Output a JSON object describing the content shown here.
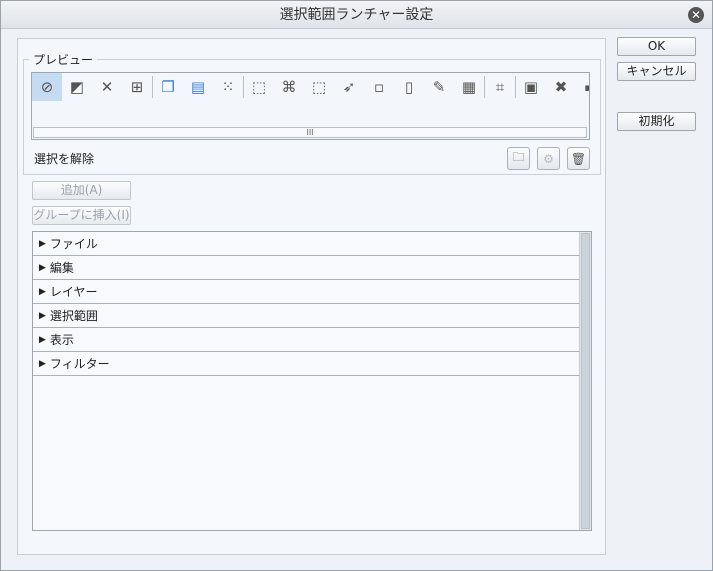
{
  "window": {
    "title": "選択範囲ランチャー設定"
  },
  "buttons": {
    "ok": "OK",
    "cancel": "キャンセル",
    "reset": "初期化",
    "add": "追加(A)",
    "insert_group": "グループに挿入(I)"
  },
  "preview": {
    "legend": "プレビュー",
    "icons": [
      "deselect-icon",
      "invert-selection-icon",
      "expand-selection-icon",
      "shrink-selection-icon",
      "copy-icon",
      "paste-icon",
      "points-icon",
      "transform-icon",
      "scale-icon",
      "free-transform-icon",
      "fill-icon",
      "new-layer-icon",
      "selection-layer-icon",
      "brush-icon",
      "checker-icon",
      "crop-icon",
      "frame-icon",
      "x-icon",
      "more-icon"
    ],
    "scroll_grip": "III",
    "selected_action": "選択を解除"
  },
  "tree": {
    "items": [
      {
        "label": "ファイル"
      },
      {
        "label": "編集"
      },
      {
        "label": "レイヤー"
      },
      {
        "label": "選択範囲"
      },
      {
        "label": "表示"
      },
      {
        "label": "フィルター"
      }
    ]
  }
}
